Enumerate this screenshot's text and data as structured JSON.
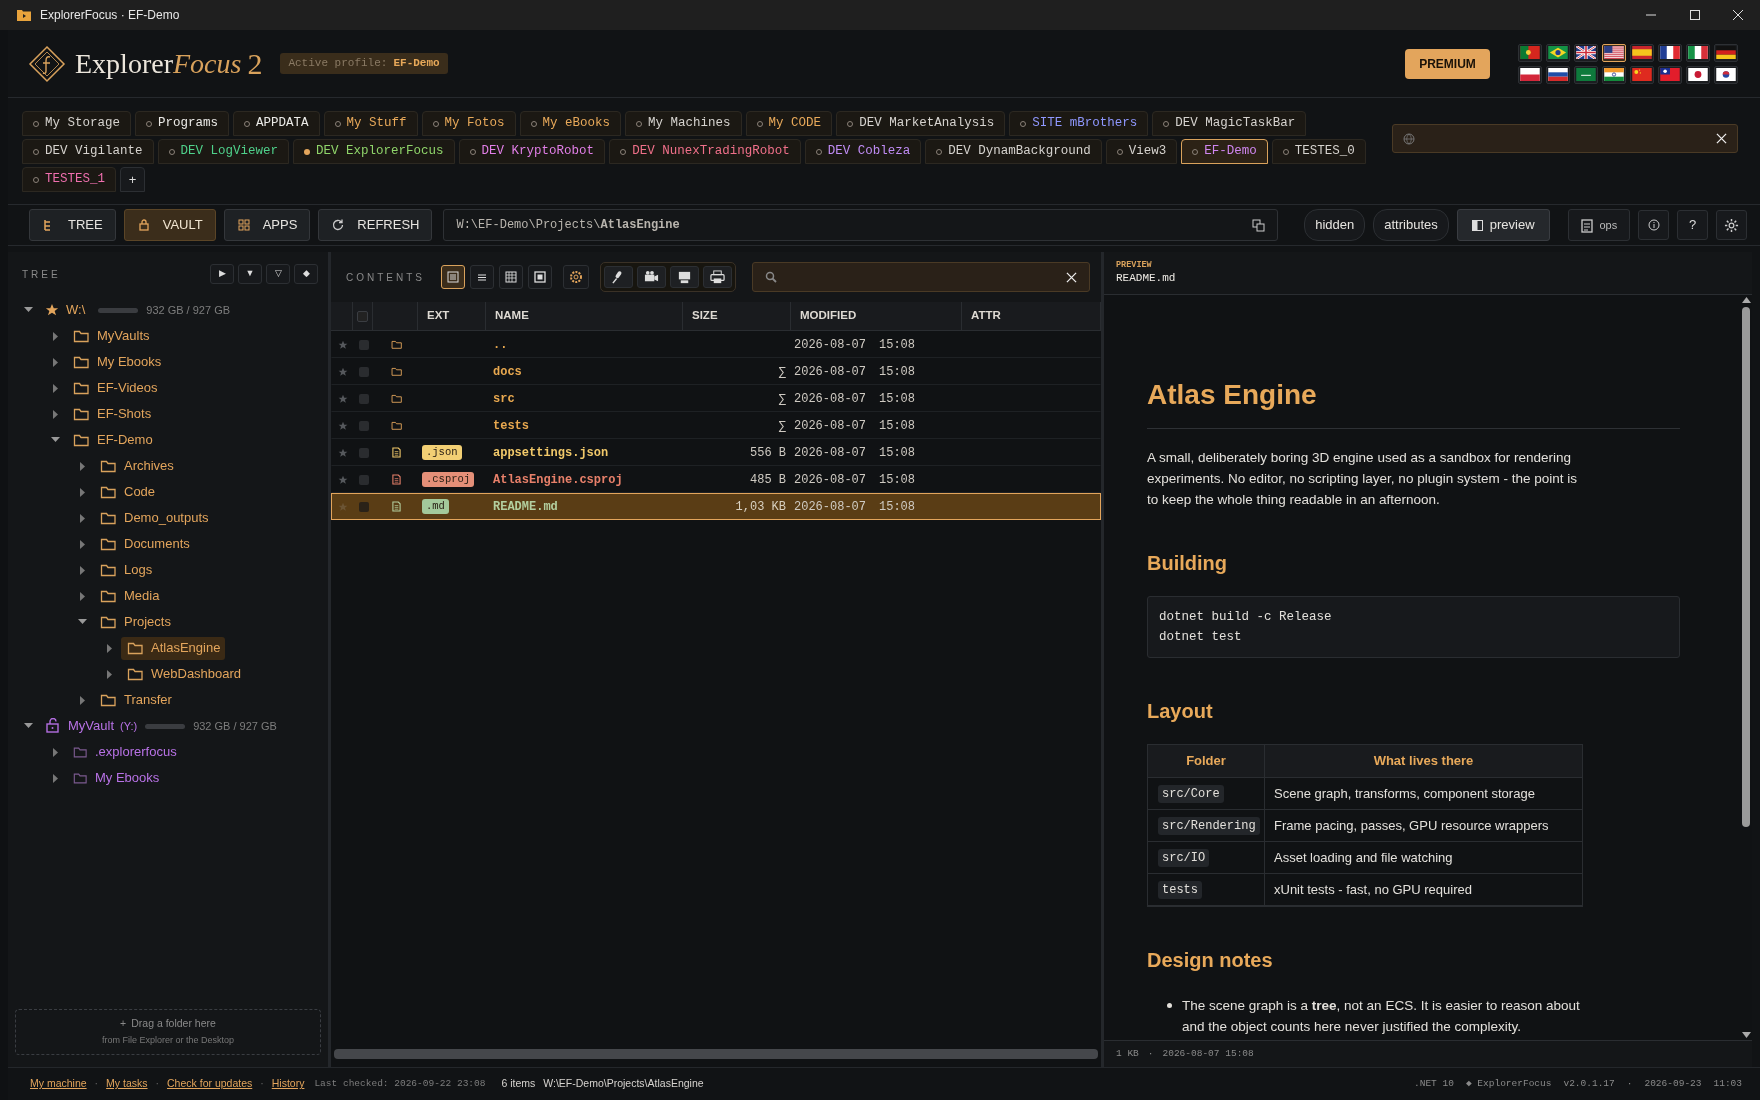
{
  "window": {
    "title": "ExplorerFocus · EF-Demo"
  },
  "header": {
    "logo_text": "Explorer",
    "logo_accent": "Focus",
    "logo_version": "2",
    "profile_label": "Active profile:",
    "profile_name": "EF-Demo",
    "premium_button": "PREMIUM",
    "languages": [
      {
        "kind": "portugal",
        "selected": false
      },
      {
        "kind": "brazil",
        "selected": false
      },
      {
        "kind": "uk",
        "selected": false
      },
      {
        "kind": "usa",
        "selected": true
      },
      {
        "kind": "spain",
        "selected": false
      },
      {
        "kind": "france",
        "selected": false
      },
      {
        "kind": "italy",
        "selected": false
      },
      {
        "kind": "germany",
        "selected": false
      },
      {
        "kind": "poland",
        "selected": false
      },
      {
        "kind": "russia",
        "selected": false
      },
      {
        "kind": "saudi",
        "selected": false
      },
      {
        "kind": "india",
        "selected": false
      },
      {
        "kind": "china",
        "selected": false
      },
      {
        "kind": "taiwan",
        "selected": false
      },
      {
        "kind": "japan",
        "selected": false
      },
      {
        "kind": "korea",
        "selected": false
      }
    ]
  },
  "tab_rows": [
    [
      {
        "label": "My Storage",
        "color": "#d6d3cf",
        "selected": false,
        "marked": false
      },
      {
        "label": "Programs",
        "color": "#ecebe8",
        "selected": false,
        "marked": false
      },
      {
        "label": "APPDATA",
        "color": "#ecebe8",
        "selected": false,
        "marked": false
      },
      {
        "label": "My Stuff",
        "color": "#e8a95a",
        "selected": false,
        "marked": false
      },
      {
        "label": "My Fotos",
        "color": "#e8a95a",
        "selected": false,
        "marked": false
      },
      {
        "label": "My eBooks",
        "color": "#e8a95a",
        "selected": false,
        "marked": false
      },
      {
        "label": "My Machines",
        "color": "#d6d3cf",
        "selected": false,
        "marked": false
      },
      {
        "label": "My CODE",
        "color": "#e8a95a",
        "selected": false,
        "marked": false
      },
      {
        "label": "DEV MarketAnalysis",
        "color": "#d6d3cf",
        "selected": false,
        "marked": false
      },
      {
        "label": "SITE mBrothers",
        "color": "#8f98ff",
        "selected": false,
        "marked": false
      },
      {
        "label": "DEV MagicTaskBar",
        "color": "#d6d3cf",
        "selected": false,
        "marked": false
      }
    ],
    [
      {
        "label": "DEV Vigilante",
        "color": "#d6d3cf",
        "selected": false,
        "marked": false
      },
      {
        "label": "DEV LogViewer",
        "color": "#4fd18b",
        "selected": false,
        "marked": false
      },
      {
        "label": "DEV ExplorerFocus",
        "color": "#8fd46a",
        "selected": false,
        "marked": true
      },
      {
        "label": "DEV KryptoRobot",
        "color": "#e27fe8",
        "selected": false,
        "marked": false
      },
      {
        "label": "DEV NunexTradingRobot",
        "color": "#f0708a",
        "selected": false,
        "marked": false
      },
      {
        "label": "DEV Cobleza",
        "color": "#c08cf5",
        "selected": false,
        "marked": false
      },
      {
        "label": "DEV DynamBackground",
        "color": "#d6d3cf",
        "selected": false,
        "marked": false
      },
      {
        "label": "View3",
        "color": "#d6d3cf",
        "selected": false,
        "marked": false
      },
      {
        "label": "EF-Demo",
        "color": "#cf86f0",
        "selected": true,
        "marked": false
      },
      {
        "label": "TESTES_0",
        "color": "#d6d3cf",
        "selected": false,
        "marked": false
      }
    ],
    [
      {
        "label": "TESTES_1",
        "color": "#ef6fae",
        "selected": false,
        "marked": false
      }
    ]
  ],
  "add_tab": "+",
  "toolbar": {
    "buttons": [
      {
        "label": "TREE",
        "kind": "tree",
        "on": false
      },
      {
        "label": "VAULT",
        "kind": "vault",
        "on": true
      },
      {
        "label": "APPS",
        "kind": "apps",
        "on": false
      },
      {
        "label": "REFRESH",
        "kind": "refresh",
        "on": false
      }
    ],
    "path": "W:\\EF-Demo\\Projects\\**AtlasEngine**",
    "toggles": [
      {
        "label": "hidden",
        "on": false
      },
      {
        "label": "attributes",
        "on": false
      },
      {
        "label": "preview",
        "on": true
      }
    ],
    "ops": "ops",
    "help": "?"
  },
  "tree": {
    "title": "TREE",
    "controls": [
      "▶",
      "▼",
      "▽",
      "◆"
    ],
    "nodes": [
      {
        "label": "W:\\",
        "kind": "drive",
        "usage": "932 GB / 927 GB",
        "expanded": true,
        "selected": false,
        "children": [
          {
            "label": "MyVaults",
            "kind": "folder",
            "expanded": false,
            "selected": false
          },
          {
            "label": "My Ebooks",
            "kind": "folder",
            "expanded": false,
            "selected": false
          },
          {
            "label": "EF-Videos",
            "kind": "folder",
            "expanded": false,
            "selected": false
          },
          {
            "label": "EF-Shots",
            "kind": "folder",
            "expanded": false,
            "selected": false
          },
          {
            "label": "EF-Demo",
            "kind": "folder",
            "expanded": true,
            "selected": false,
            "children": [
              {
                "label": "Archives",
                "kind": "folder",
                "expanded": false,
                "selected": false
              },
              {
                "label": "Code",
                "kind": "folder",
                "expanded": false,
                "selected": false
              },
              {
                "label": "Demo_outputs",
                "kind": "folder",
                "expanded": false,
                "selected": false
              },
              {
                "label": "Documents",
                "kind": "folder",
                "expanded": false,
                "selected": false
              },
              {
                "label": "Logs",
                "kind": "folder",
                "expanded": false,
                "selected": false
              },
              {
                "label": "Media",
                "kind": "folder",
                "expanded": false,
                "selected": false
              },
              {
                "label": "Projects",
                "kind": "folder",
                "expanded": true,
                "selected": false,
                "children": [
                  {
                    "label": "AtlasEngine",
                    "kind": "folder",
                    "expanded": false,
                    "selected": true
                  },
                  {
                    "label": "WebDashboard",
                    "kind": "folder",
                    "expanded": false,
                    "selected": false
                  }
                ]
              },
              {
                "label": "Transfer",
                "kind": "folder",
                "expanded": false,
                "selected": false
              }
            ]
          }
        ]
      },
      {
        "label": "MyVault",
        "letter": "(Y:)",
        "kind": "vault",
        "usage": "932 GB / 927 GB",
        "expanded": true,
        "selected": false,
        "children": [
          {
            "label": ".explorerfocus",
            "kind": "vault-folder",
            "expanded": false,
            "selected": false
          },
          {
            "label": "My Ebooks",
            "kind": "vault-folder",
            "expanded": false,
            "selected": false
          }
        ]
      }
    ],
    "drop_hint": {
      "plus": "+",
      "title": "Drag a folder here",
      "subtitle": "from File Explorer or the Desktop"
    }
  },
  "contents": {
    "title": "CONTENTS",
    "views": [
      {
        "kind": "details",
        "selected": true
      },
      {
        "kind": "list",
        "selected": false
      },
      {
        "kind": "grid",
        "selected": false
      },
      {
        "kind": "single",
        "selected": false
      }
    ],
    "select_all": {
      "checked": false
    },
    "columns": [
      "EXT",
      "NAME",
      "SIZE",
      "MODIFIED",
      "ATTR"
    ],
    "rows": [
      {
        "kind": "folder",
        "name": "..",
        "date": "2026-08-07",
        "time": "15:08",
        "color": "#e8a84f",
        "selected": false
      },
      {
        "kind": "folder",
        "name": "docs",
        "size": "∑",
        "date": "2026-08-07",
        "time": "15:08",
        "color": "#e8a84f",
        "selected": false
      },
      {
        "kind": "folder",
        "name": "src",
        "size": "∑",
        "date": "2026-08-07",
        "time": "15:08",
        "color": "#e8a84f",
        "selected": false
      },
      {
        "kind": "folder",
        "name": "tests",
        "size": "∑",
        "date": "2026-08-07",
        "time": "15:08",
        "color": "#e8a84f",
        "selected": false
      },
      {
        "kind": "file",
        "ext": {
          "text": ".json",
          "color": "#f2cf74"
        },
        "name": "appsettings.json",
        "size": "556 B",
        "date": "2026-08-07",
        "time": "15:08",
        "color": "#f2c96a",
        "selected": false
      },
      {
        "kind": "file",
        "ext": {
          "text": ".csproj",
          "color": "#e48f78"
        },
        "name": "AtlasEngine.csproj",
        "size": "485 B",
        "date": "2026-08-07",
        "time": "15:08",
        "color": "#e8806a",
        "selected": false
      },
      {
        "kind": "file",
        "ext": {
          "text": ".md",
          "color": "#a3c99b"
        },
        "name": "README.md",
        "size": "1,03 KB",
        "date": "2026-08-07",
        "time": "15:08",
        "color": "#b3cf9f",
        "selected": true
      }
    ]
  },
  "preview": {
    "label": "PREVIEW",
    "file": "README.md",
    "blocks": [
      {
        "kind": "h1",
        "text": "Atlas Engine"
      },
      {
        "kind": "p",
        "text": "A small, deliberately boring 3D engine used as a sandbox for rendering experiments. No editor, no scripting layer, no plugin system - the point is to keep the whole thing readable in an afternoon."
      },
      {
        "kind": "h2",
        "text": "Building"
      },
      {
        "kind": "code",
        "lines": [
          "dotnet build -c Release",
          "dotnet test"
        ]
      },
      {
        "kind": "h2",
        "text": "Layout"
      },
      {
        "kind": "table",
        "columns": [
          "Folder",
          "What lives there"
        ],
        "rows": [
          [
            "src/Core",
            "Scene graph, transforms, component storage"
          ],
          [
            "src/Rendering",
            "Frame pacing, passes, GPU resource wrappers"
          ],
          [
            "src/IO",
            "Asset loading and file watching"
          ],
          [
            "tests",
            "xUnit tests - fast, no GPU required"
          ]
        ]
      },
      {
        "kind": "h2",
        "text": "Design notes"
      },
      {
        "kind": "list",
        "items": [
          "The scene graph is a **tree**, not an ECS. It is easier to reason about and the object counts here never justified the complexity."
        ]
      }
    ],
    "footer": [
      "1 KB",
      "·",
      "2026-08-07 15:08"
    ]
  },
  "status_bar": {
    "items": [
      {
        "kind": "link",
        "text": "My machine"
      },
      {
        "kind": "sep",
        "text": "·"
      },
      {
        "kind": "link",
        "text": "My tasks"
      },
      {
        "kind": "sep",
        "text": "·"
      },
      {
        "kind": "link",
        "text": "Check for updates"
      },
      {
        "kind": "sep",
        "text": "·"
      },
      {
        "kind": "link",
        "text": "History"
      },
      {
        "kind": "mono",
        "text": "Last checked: 2026-09-22 23:08"
      },
      {
        "kind": "plain",
        "text": "6 items"
      },
      {
        "kind": "plain",
        "text": "W:\\EF-Demo\\Projects\\AtlasEngine"
      }
    ],
    "right": [
      ".NET 10",
      "◆ ExplorerFocus",
      "v2.0.1.17",
      "·",
      "2026-09-23",
      "11:03"
    ]
  }
}
